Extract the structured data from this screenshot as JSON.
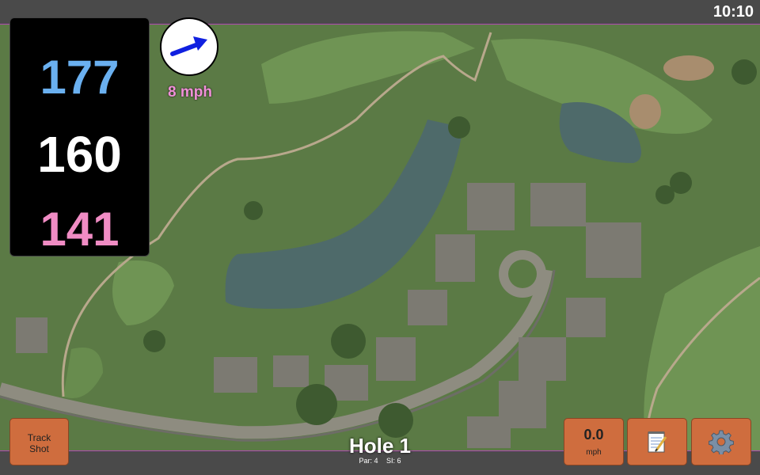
{
  "status": {
    "time": "10:10"
  },
  "distances": {
    "back": "177",
    "middle": "160",
    "front": "141"
  },
  "wind": {
    "speed_label": "8 mph",
    "direction_icon": "wind-arrow-icon"
  },
  "hole": {
    "title": "Hole 1",
    "par": "Par: 4",
    "stroke_index": "SI: 6"
  },
  "buttons": {
    "track_shot_line1": "Track",
    "track_shot_line2": "Shot",
    "wind_value": "0.0",
    "wind_unit": "mph",
    "scorecard_icon": "notepad-icon",
    "settings_icon": "gear-icon"
  },
  "colors": {
    "back": "#6ab0f0",
    "middle": "#ffffff",
    "front": "#f08cc4",
    "accent": "#cf6d3e",
    "wind_label": "#f090d8"
  }
}
